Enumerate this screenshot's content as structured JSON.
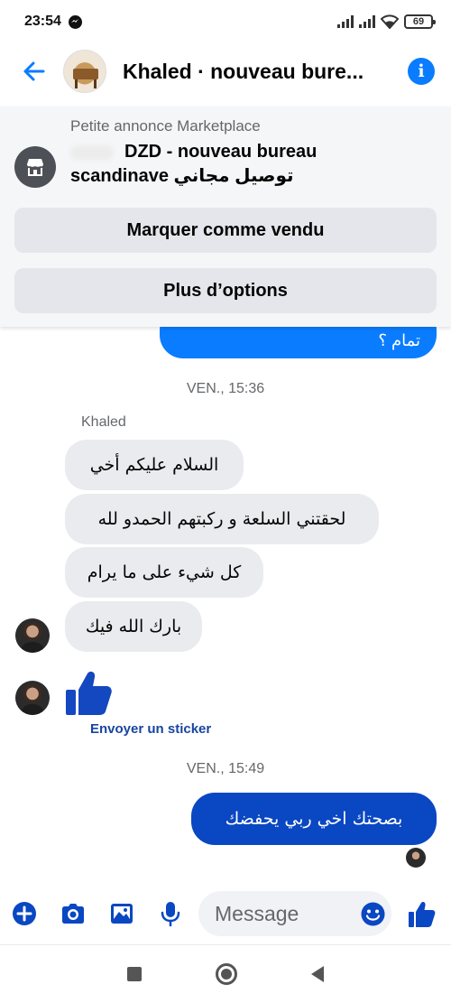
{
  "status_bar": {
    "time": "23:54",
    "battery": "69"
  },
  "header": {
    "title": "Khaled · nouveau bure..."
  },
  "marketplace": {
    "label": "Petite annonce Marketplace",
    "title_line1": "DZD - nouveau bureau",
    "title_line2": "scandinave توصيل مجاني",
    "mark_sold_button": "Marquer comme vendu",
    "more_options_button": "Plus d’options"
  },
  "chat": {
    "partial_outgoing": "تمام ؟",
    "timestamp_1": "VEN., 15:36",
    "sender_name": "Khaled",
    "incoming_messages": [
      "السلام عليكم أخي",
      "لحقتني السلعة و ركبتهم الحمدو لله",
      "كل شيء على ما يرام",
      "بارك الله فيك"
    ],
    "sticker_link": "Envoyer un sticker",
    "timestamp_2": "VEN., 15:49",
    "outgoing_message": "بصحتك اخي ربي يحفضك"
  },
  "composer": {
    "placeholder": "Message"
  },
  "icons": {
    "status_app": "messenger-icon",
    "back": "arrow-left-icon",
    "info": "info-icon",
    "shop": "storefront-icon",
    "plus": "plus-circle-icon",
    "camera": "camera-icon",
    "gallery": "image-icon",
    "mic": "microphone-icon",
    "emoji": "emoji-icon",
    "like": "thumbs-up-icon"
  },
  "colors": {
    "accent": "#0a7cff",
    "outgoing_bubble": "#0a47c2",
    "incoming_bubble": "#e9ebee",
    "composer_icons": "#0a47c2"
  }
}
